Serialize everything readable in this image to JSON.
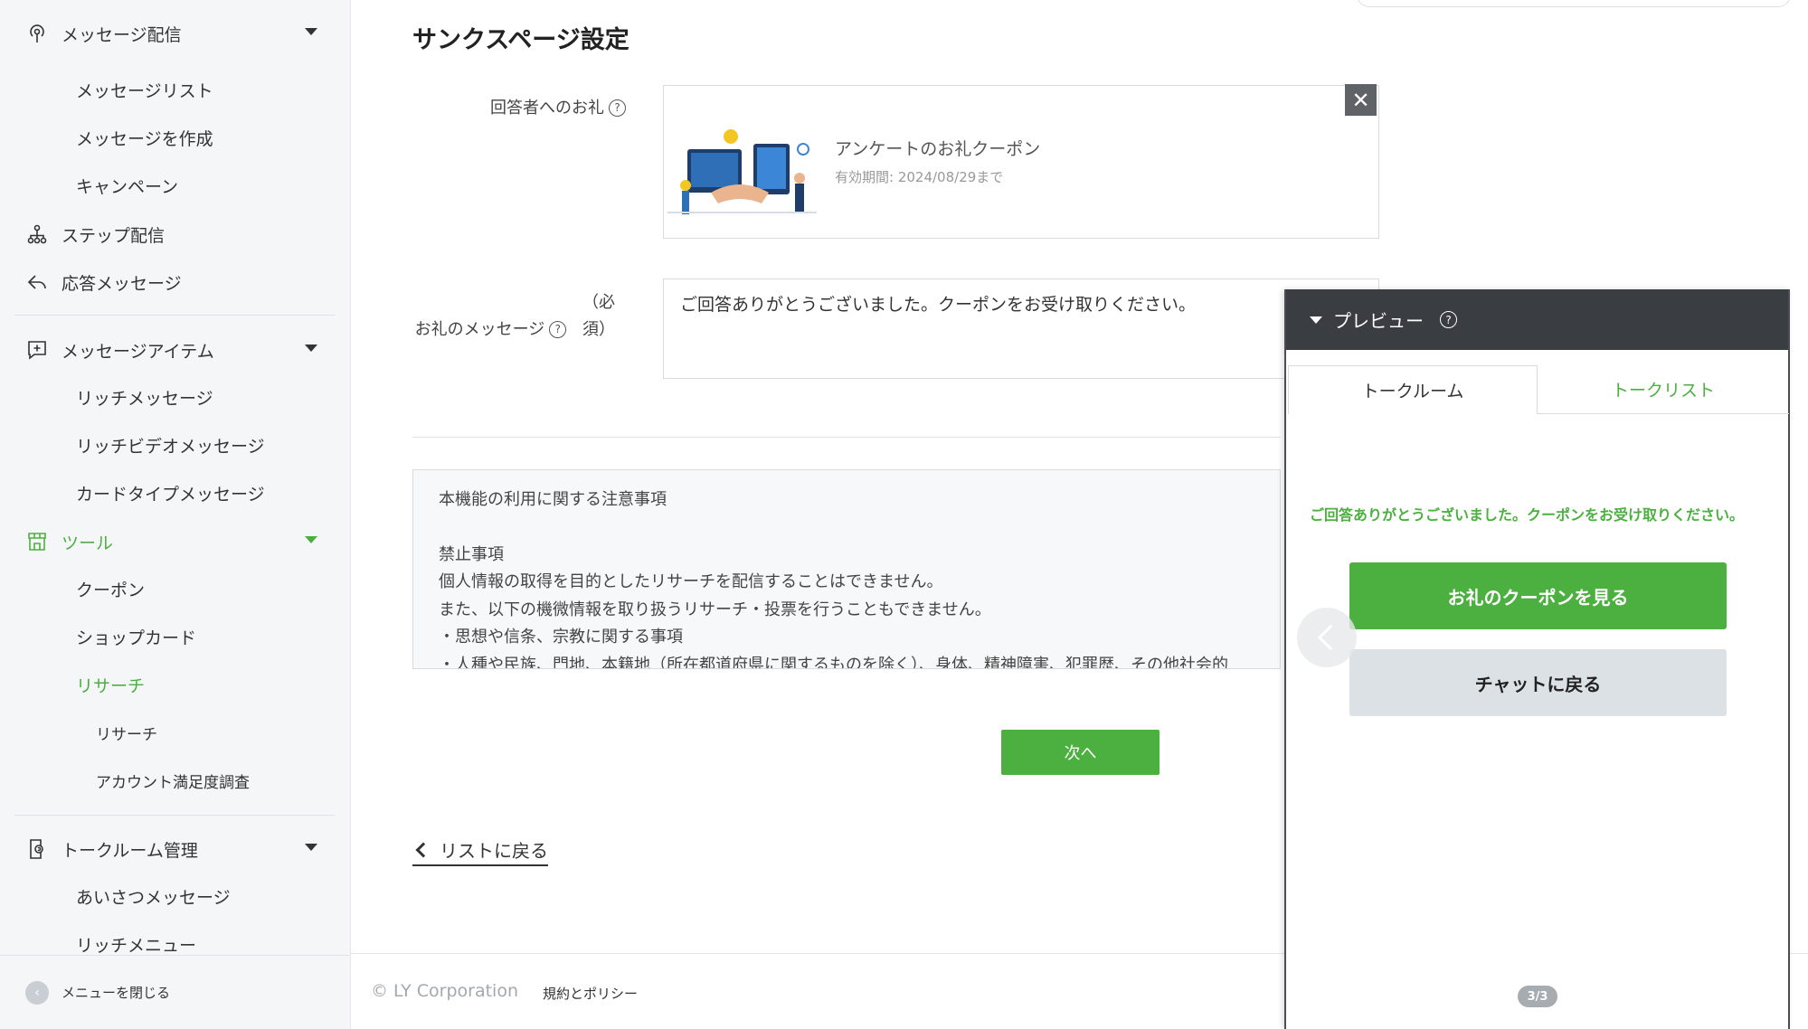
{
  "sidebar": {
    "groups": [
      {
        "label": "メッセージ配信",
        "icon": "broadcast-icon",
        "subs": [
          "メッセージリスト",
          "メッセージを作成",
          "キャンペーン"
        ]
      },
      {
        "label": "ステップ配信",
        "icon": "step-icon"
      },
      {
        "label": "応答メッセージ",
        "icon": "reply-icon"
      },
      {
        "label": "メッセージアイテム",
        "icon": "message-item-icon",
        "subs": [
          "リッチメッセージ",
          "リッチビデオメッセージ",
          "カードタイプメッセージ"
        ]
      },
      {
        "label": "ツール",
        "icon": "shop-icon",
        "subs": [
          "クーポン",
          "ショップカード",
          "リサーチ"
        ],
        "subsubs": [
          "リサーチ",
          "アカウント満足度調査"
        ]
      },
      {
        "label": "トークルーム管理",
        "icon": "talkroom-icon",
        "subs": [
          "あいさつメッセージ",
          "リッチメニュー"
        ]
      }
    ],
    "close_menu": "メニューを閉じる",
    "accent_color": "#4cb040"
  },
  "main": {
    "title": "サンクスページ設定",
    "gift_label": "回答者へのお礼",
    "coupon": {
      "title": "アンケートのお礼クーポン",
      "expiry": "有効期間: 2024/08/29まで",
      "close": "✕"
    },
    "message_label": "お礼のメッセージ",
    "message_required": "（必須）",
    "message_value": "ご回答ありがとうございました。クーポンをお受け取りください。",
    "notice": {
      "heading": "本機能の利用に関する注意事項",
      "prohibited": "禁止事項",
      "line1": "個人情報の取得を目的としたリサーチを配信することはできません。",
      "line2": "また、以下の機微情報を取り扱うリサーチ・投票を行うこともできません。",
      "line3": "・思想や信条、宗教に関する事項",
      "line4": "・人種や民族、門地、本籍地（所在都道府県に関するものを除く）、身体、精神障害、犯罪歴、その他社会的"
    },
    "next_button": "次へ",
    "back_link": "リストに戻る"
  },
  "footer": {
    "copyright": "© LY Corporation",
    "policy": "規約とポリシー"
  },
  "preview": {
    "title": "プレビュー",
    "tabs": [
      "トークルーム",
      "トークリスト"
    ],
    "message": "ご回答ありがとうございました。クーポンをお受け取りください。",
    "coupon_button": "お礼のクーポンを見る",
    "back_button": "チャットに戻る",
    "pager": "3/3"
  }
}
